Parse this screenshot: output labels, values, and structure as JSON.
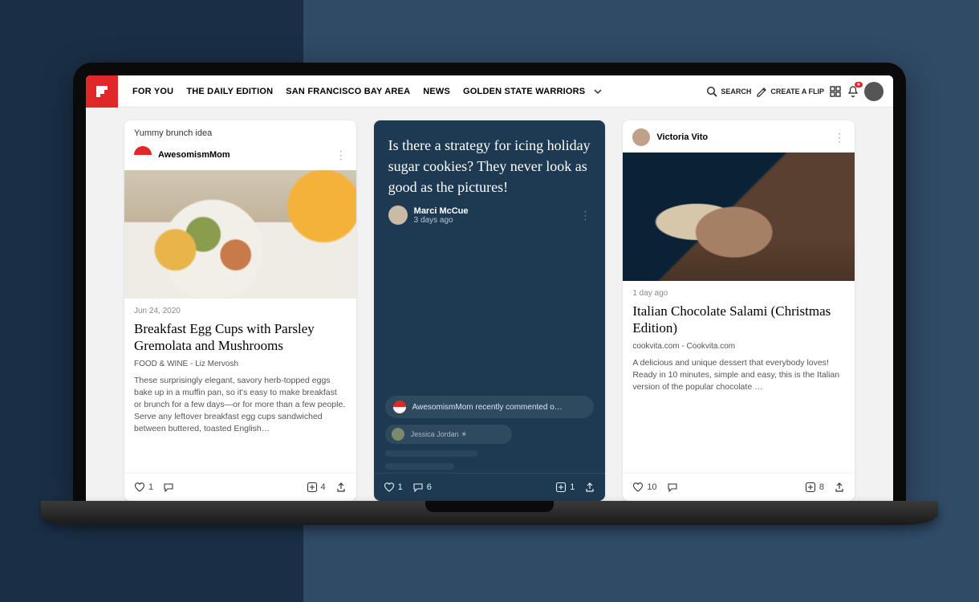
{
  "header": {
    "nav": [
      "FOR YOU",
      "THE DAILY EDITION",
      "SAN FRANCISCO BAY AREA",
      "NEWS",
      "GOLDEN STATE WARRIORS"
    ],
    "search_label": "SEARCH",
    "create_label": "CREATE A FLIP",
    "notification_badge": "●"
  },
  "cards": [
    {
      "pretitle": "Yummy brunch idea",
      "author": "AwesomismMom",
      "date": "Jun 24, 2020",
      "title": "Breakfast Egg Cups with Parsley Gremolata and Mushrooms",
      "source": "FOOD & WINE - Liz Mervosh",
      "desc": "These surprisingly elegant, savory herb-topped eggs bake up in a muffin pan, so it's easy to make breakfast or brunch for a few days—or for more than a few people. Serve any leftover breakfast egg cups sandwiched between buttered, toasted English…",
      "like_count": "1",
      "add_count": "4"
    },
    {
      "note_text": "Is there a strategy for icing holiday sugar cookies? They never look as good as the pictures!",
      "author": "Marci McCue",
      "time": "3 days ago",
      "comment1": "AwesomismMom recently commented o…",
      "comment2": "Jessica Jordan ☀",
      "like_count": "1",
      "comment_count": "6",
      "add_count": "1"
    },
    {
      "author": "Victoria Vito",
      "date": "1 day ago",
      "title": "Italian Chocolate Salami (Christmas Edition)",
      "source": "cookvita.com - Cookvita.com",
      "desc": "A delicious and unique dessert that everybody loves! Ready in 10 minutes, simple and easy, this is the Italian version of the popular chocolate …",
      "like_count": "10",
      "add_count": "8"
    }
  ]
}
